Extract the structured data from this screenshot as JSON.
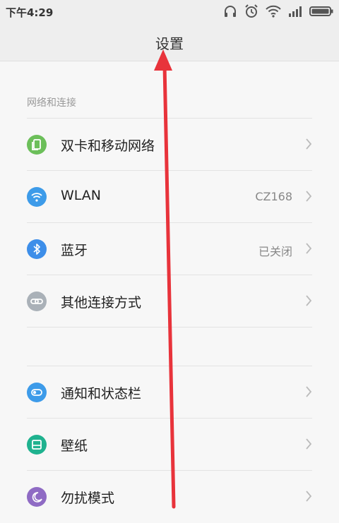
{
  "status_bar": {
    "time": "下午4:29",
    "icons": [
      "headphones-icon",
      "alarm-icon",
      "wifi-icon",
      "signal-icon",
      "battery-icon"
    ]
  },
  "header": {
    "title": "设置"
  },
  "section_network": {
    "title": "网络和连接"
  },
  "rows": [
    {
      "label": "双卡和移动网络",
      "value": "",
      "icon": "sim-card-icon",
      "color": "#6cbf5a"
    },
    {
      "label": "WLAN",
      "value": "CZ168",
      "icon": "wifi-icon",
      "color": "#3d9be9"
    },
    {
      "label": "蓝牙",
      "value": "已关闭",
      "icon": "bluetooth-icon",
      "color": "#3d8ee9"
    },
    {
      "label": "其他连接方式",
      "value": "",
      "icon": "link-icon",
      "color": "#aab1b8"
    },
    {
      "label": "通知和状态栏",
      "value": "",
      "icon": "notification-icon",
      "color": "#3d9be9"
    },
    {
      "label": "壁纸",
      "value": "",
      "icon": "wallpaper-icon",
      "color": "#1fb28f"
    },
    {
      "label": "勿扰模式",
      "value": "",
      "icon": "moon-icon",
      "color": "#8f6bc4"
    }
  ],
  "annotation_color": "#e8333b"
}
